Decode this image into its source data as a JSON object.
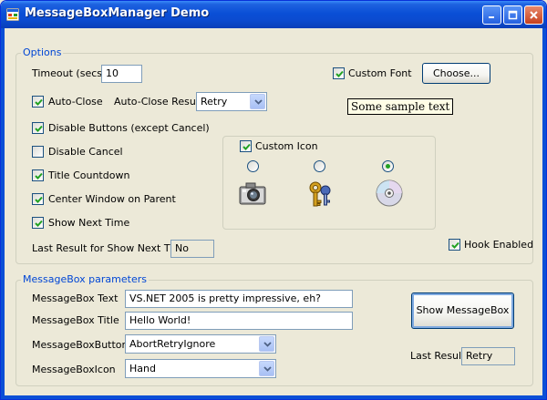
{
  "window": {
    "title": "MessageBoxManager Demo"
  },
  "options": {
    "group_title": "Options",
    "timeout_label": "Timeout (secs)",
    "timeout_value": "10",
    "custom_font_label": "Custom Font",
    "custom_font_checked": true,
    "choose_button": "Choose...",
    "sample_text": "Some sample text",
    "auto_close_label": "Auto-Close",
    "auto_close_checked": true,
    "auto_close_result_label": "Auto-Close Result",
    "auto_close_result_value": "Retry",
    "disable_buttons_label": "Disable Buttons (except Cancel)",
    "disable_buttons_checked": true,
    "disable_cancel_label": "Disable Cancel",
    "disable_cancel_checked": false,
    "title_countdown_label": "Title Countdown",
    "title_countdown_checked": true,
    "center_window_label": "Center Window on Parent",
    "center_window_checked": true,
    "show_next_time_label": "Show Next Time",
    "show_next_time_checked": true,
    "last_result_snt_label": "Last Result for Show Next Time",
    "last_result_snt_value": "No",
    "hook_enabled_label": "Hook Enabled",
    "hook_enabled_checked": true,
    "custom_icon_label": "Custom Icon",
    "custom_icon_checked": true,
    "icons": [
      {
        "name": "camera-icon",
        "selected": false
      },
      {
        "name": "keys-icon",
        "selected": false
      },
      {
        "name": "cd-icon",
        "selected": true
      }
    ]
  },
  "params": {
    "group_title": "MessageBox parameters",
    "text_label": "MessageBox Text",
    "text_value": "VS.NET 2005 is pretty impressive, eh?",
    "title_label": "MessageBox Title",
    "title_value": "Hello World!",
    "buttons_label": "MessageBoxButtons",
    "buttons_value": "AbortRetryIgnore",
    "icon_label": "MessageBoxIcon",
    "icon_value": "Hand",
    "show_button": "Show MessageBox",
    "last_result_label": "Last Result",
    "last_result_value": "Retry"
  },
  "colors": {
    "title_bar": "#0a4fd6",
    "window_bg": "#ece9d8",
    "group_title": "#0046d5",
    "check_mark": "#21a121"
  }
}
